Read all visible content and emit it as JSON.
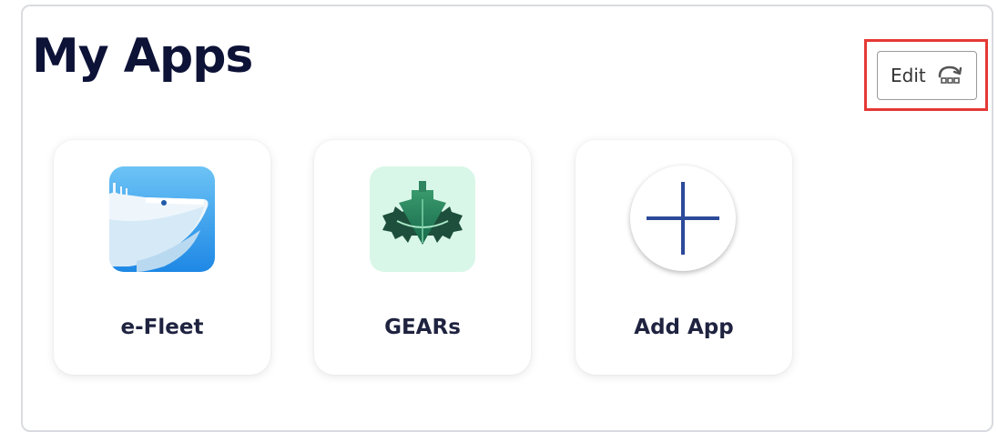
{
  "page": {
    "title": "My Apps"
  },
  "toolbar": {
    "edit_label": "Edit",
    "edit_icon": "edit-grid-icon"
  },
  "apps": [
    {
      "label": "e-Fleet",
      "icon": "ship-icon",
      "color": "#2196f3"
    },
    {
      "label": "GEARs",
      "icon": "ship-gear-icon",
      "color": "#1e6b4f"
    },
    {
      "label": "Add App",
      "icon": "plus-icon",
      "color": "#2c4a9a"
    }
  ],
  "colors": {
    "title": "#0d1237",
    "highlight": "#e53935",
    "card_label": "#1f2340"
  }
}
